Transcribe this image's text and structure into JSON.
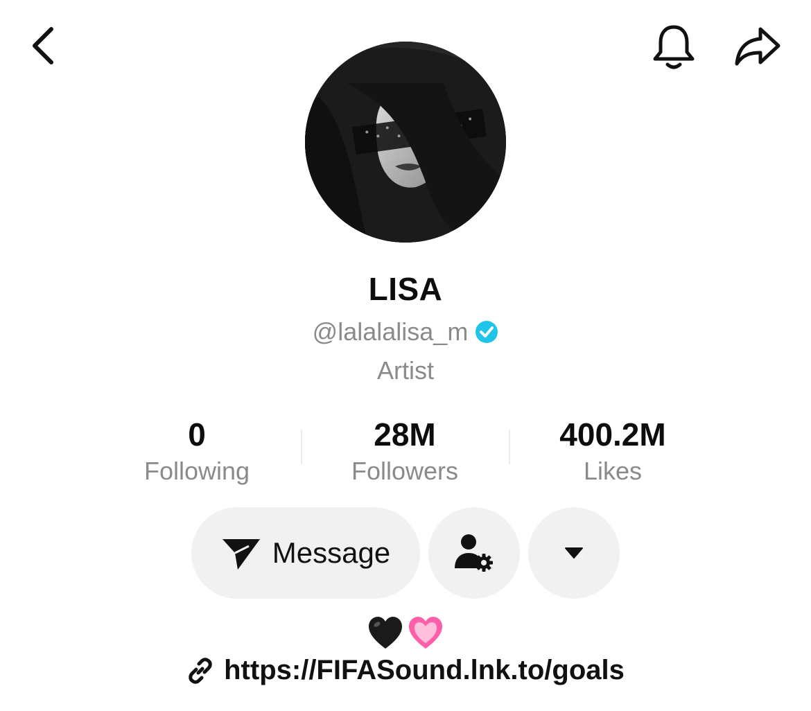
{
  "header": {
    "back_icon": "chevron-left-icon",
    "bell_icon": "bell-icon",
    "share_icon": "share-arrow-icon"
  },
  "profile": {
    "display_name": "LISA",
    "username": "@lalalalisa_m",
    "verified": true,
    "verified_color": "#20c4e8",
    "category": "Artist"
  },
  "stats": {
    "following": {
      "value": "0",
      "label": "Following"
    },
    "followers": {
      "value": "28M",
      "label": "Followers"
    },
    "likes": {
      "value": "400.2M",
      "label": "Likes"
    }
  },
  "actions": {
    "message_label": "Message",
    "message_icon": "paper-plane-icon",
    "follow_settings_icon": "person-gear-icon",
    "more_icon": "caret-down-icon"
  },
  "bio": {
    "emojis": [
      "🖤",
      "💗"
    ],
    "link_icon": "link-icon",
    "link": "https://FIFASound.lnk.to/goals"
  }
}
